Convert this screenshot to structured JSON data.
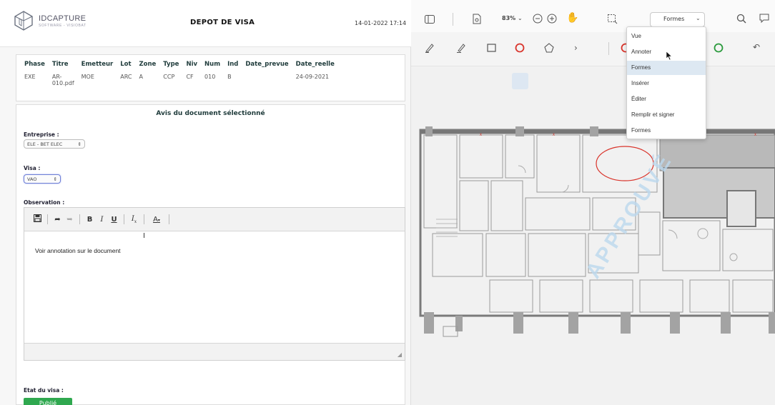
{
  "header": {
    "logo_text": "IDCAPTURE",
    "logo_sub": "SOFTWARE - VISIOBAT",
    "title": "DEPOT DE VISA",
    "datetime": "14-01-2022 17:14"
  },
  "doc_table": {
    "columns": [
      "Phase",
      "Titre",
      "Emetteur",
      "Lot",
      "Zone",
      "Type",
      "Niv",
      "Num",
      "Ind",
      "Date_prevue",
      "Date_reelle"
    ],
    "row": {
      "phase": "EXE",
      "titre_1": "AR-",
      "titre_2": "010.pdf",
      "emetteur": "MOE",
      "lot": "ARC",
      "zone": "A",
      "type": "CCP",
      "niv": "CF",
      "num": "010",
      "ind": "B",
      "date_prevue": "",
      "date_reelle": "24-09-2021"
    }
  },
  "avis": {
    "title": "Avis du document sélectionné",
    "entreprise_label": "Entreprise :",
    "entreprise_value": "ELE - BET ELEC",
    "visa_label": "Visa :",
    "visa_value": "VAO",
    "observation_label": "Observation :",
    "editor_text": "Voir annotation sur le document",
    "etat_label": "Etat du visa :",
    "etat_button": "Publié"
  },
  "viewer": {
    "zoom": "83%",
    "mode_selected": "Formes",
    "colors": {
      "red": "#d9342b",
      "green": "#2a9a3c",
      "accent": "#6e7fd6"
    },
    "dropdown": [
      "Vue",
      "Annoter",
      "Formes",
      "Insérer",
      "Éditer",
      "Remplir et signer",
      "Formes"
    ],
    "dropdown_highlighted": 2,
    "watermark": "APPROUVÉ",
    "icons": [
      "sidebar-icon",
      "page-icon",
      "zoom-out-icon",
      "zoom-in-icon",
      "pan-hand-icon",
      "select-area-icon",
      "search-icon",
      "comment-icon",
      "pen-icon",
      "highlighter-icon",
      "rectangle-icon",
      "ellipse-icon",
      "polygon-icon",
      "more-chevron-icon",
      "undo-icon"
    ]
  }
}
